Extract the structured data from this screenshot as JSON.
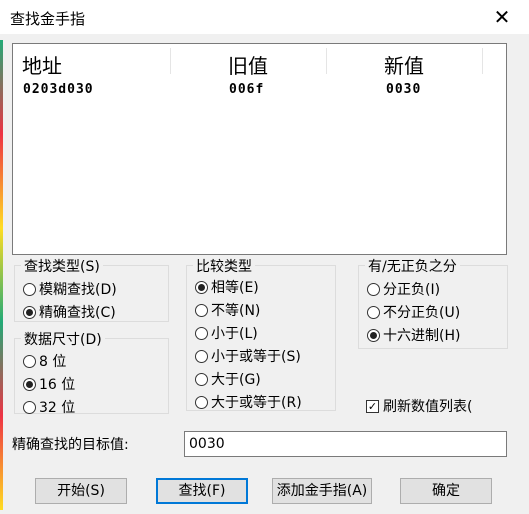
{
  "window": {
    "title": "查找金手指"
  },
  "list": {
    "columns": [
      "地址",
      "旧值",
      "新值"
    ],
    "rows": [
      {
        "address": "0203d030",
        "old": "006f",
        "new": "0030"
      }
    ]
  },
  "search_type": {
    "label": "查找类型(S)",
    "options": [
      {
        "label": "模糊查找(D)",
        "checked": false
      },
      {
        "label": "精确查找(C)",
        "checked": true
      }
    ]
  },
  "data_size": {
    "label": "数据尺寸(D)",
    "options": [
      {
        "label": "8 位",
        "checked": false
      },
      {
        "label": "16 位",
        "checked": true
      },
      {
        "label": "32 位",
        "checked": false
      }
    ]
  },
  "compare_type": {
    "label": "比较类型",
    "options": [
      {
        "label": "相等(E)",
        "checked": true
      },
      {
        "label": "不等(N)",
        "checked": false
      },
      {
        "label": "小于(L)",
        "checked": false
      },
      {
        "label": "小于或等于(S)",
        "checked": false
      },
      {
        "label": "大于(G)",
        "checked": false
      },
      {
        "label": "大于或等于(R)",
        "checked": false
      }
    ]
  },
  "sign": {
    "label": "有/无正负之分",
    "options": [
      {
        "label": "分正负(I)",
        "checked": false
      },
      {
        "label": "不分正负(U)",
        "checked": false
      },
      {
        "label": "十六进制(H)",
        "checked": true
      }
    ]
  },
  "refresh": {
    "label": "刷新数值列表(",
    "checked": true
  },
  "target": {
    "label": "精确查找的目标值:",
    "value": "0030"
  },
  "buttons": {
    "start": "开始(S)",
    "find": "查找(F)",
    "add": "添加金手指(A)",
    "ok": "确定"
  }
}
